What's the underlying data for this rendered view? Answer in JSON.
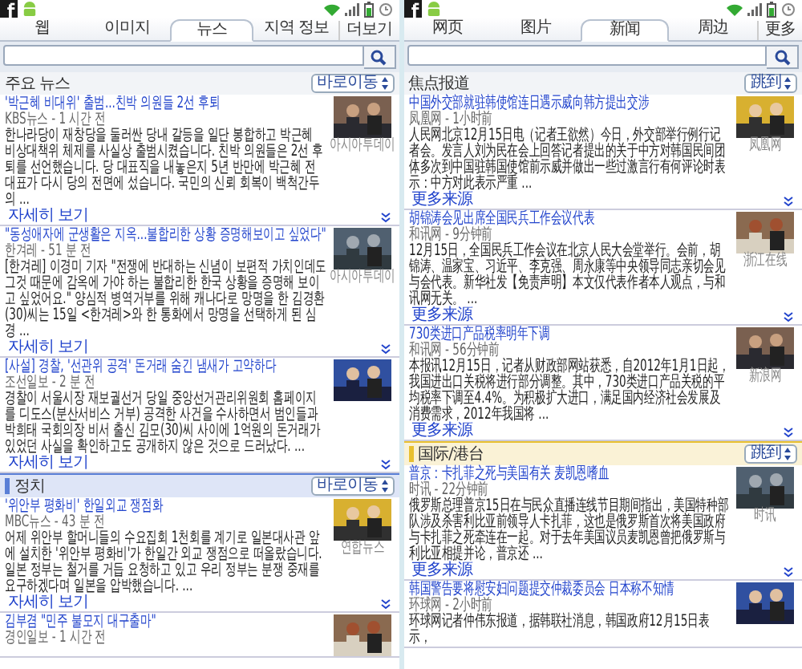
{
  "panels": [
    {
      "tabs": [
        {
          "label": "웹",
          "selected": false
        },
        {
          "label": "이미지",
          "selected": false
        },
        {
          "label": "뉴스",
          "selected": true
        },
        {
          "label": "지역 정보",
          "selected": false
        }
      ],
      "more_tab": "더보기",
      "sections": [
        {
          "kind": "top",
          "title": "주요 뉴스",
          "jump_label": "바로이동",
          "articles": [
            {
              "title": "'박근혜 비대위' 출범...친박 의원들 2선 후퇴",
              "source": "KBS뉴스 - 1 시간 전",
              "snippet": "한나라당이 재창당을 둘러싼 당내 갈등을 일단 봉합하고 박근혜 비상대책위 체제를 사실상 출범시켰습니다. 친박 의원들은 2선 후퇴를 선언했습니다. 당 대표직을 내놓은지 5년 반만에 박근혜 전 대표가 다시 당의 전면에 섰습니다. 국민의 신뢰 회복이 백척간두의 ...",
              "image_caption": "아시아투데이",
              "more_link": "자세히 보기"
            },
            {
              "title": "\"동성애자에 군생활은 지옥...불합리한 상황 증명해보이고 싶었다\"",
              "source": "한겨레 - 51 분 전",
              "snippet": "[한겨레] 이경미 기자 \"전쟁에 반대하는 신념이 보편적 가치인데도 그것 때문에 감옥에 가야 하는 불합리한 한국 상황을 증명해 보이고 싶었어요.\" 양심적 병역거부를 위해 캐나다로 망명을 한 김경환(30)씨는 15일 <한겨레>와 한 통화에서 망명을 선택하게 된 심경 ...",
              "image_caption": "아시아투데이",
              "more_link": "자세히 보기"
            },
            {
              "title": "[사설] 경찰, '선관위 공격' 돈거래 숨긴 냄새가 고약하다",
              "source": "조선일보 - 2 분 전",
              "snippet": "경찰이 서울시장 재보궐선거 당일 중앙선거관리위원회 홈페이지를 디도스(분산서비스 거부) 공격한 사건을 수사하면서 범인들과 박희태 국회의장 비서 출신 김모(30)씨 사이에 1억원의 돈거래가 있었던 사실을 확인하고도 공개하지 않은 것으로 드러났다. ...",
              "more_link": "자세히 보기"
            }
          ]
        },
        {
          "kind": "category",
          "title": "정치",
          "jump_label": "바로이동",
          "color": "#5a7fd6",
          "articles": [
            {
              "title": "'위안부 평화비' 한일외교 쟁점화",
              "source": "MBC뉴스 - 43 분 전",
              "snippet": "어제 위안부 할머니들의 수요집회 1천회를 계기로 일본대사관 앞에 설치한 '위안부 평화비'가 한일간 외교 쟁점으로 떠올랐습니다. 일본 정부는 철거를 거듭 요청하고 있고 우리 정부는 분쟁 중재를 요구하겠다며 일본을 압박했습니다. ...",
              "image_caption": "연합뉴스",
              "more_link": "자세히 보기"
            },
            {
              "title": "김부겸 \"민주 불모지 대구출마\"",
              "source": "경인일보 - 1 시간 전"
            }
          ]
        }
      ]
    },
    {
      "tabs": [
        {
          "label": "网页",
          "selected": false
        },
        {
          "label": "图片",
          "selected": false
        },
        {
          "label": "新闻",
          "selected": true
        },
        {
          "label": "周边",
          "selected": false
        }
      ],
      "more_tab": "更多",
      "sections": [
        {
          "kind": "top",
          "title": "焦点报道",
          "jump_label": "跳到",
          "articles": [
            {
              "title": "中国外交部就驻韩使馆连日遇示威向韩方提出交涉",
              "source": "凤凰网 - 1小时前",
              "snippet": "人民网北京12月15日电（记者王欲然）今日，外交部举行例行记者会。发言人刘为民在会上回答记者提出的关于中方对韩国民间团体多次到中国驻韩国使馆前示威并做出一些过激言行有何评论时表示：中方对此表示严重 ...",
              "image_caption": "凤凰网",
              "more_link": "更多来源"
            },
            {
              "title": "胡锦涛会见出席全国民兵工作会议代表",
              "source": "和讯网 - 9分钟前",
              "snippet": "12月15日，全国民兵工作会议在北京人民大会堂举行。会前，胡锦涛、温家宝、习近平、李克强、周永康等中央领导同志亲切会见与会代表。新华社发【免责声明】本文仅代表作者本人观点，与和讯网无关。 ...",
              "image_caption": "浙江在线",
              "more_link": "更多来源"
            },
            {
              "title": "730类进口产品税率明年下调",
              "source": "和讯网 - 56分钟前",
              "snippet": "本报讯12月15日，记者从财政部网站获悉，自2012年1月1日起，我国进出口关税将进行部分调整。其中，730类进口产品关税的平均税率下调至4.4%。为积极扩大进口，满足国内经济社会发展及消费需求，2012年我国将 ...",
              "image_caption": "新浪网",
              "more_link": "更多来源"
            }
          ]
        },
        {
          "kind": "category",
          "title": "国际/港台",
          "jump_label": "跳到",
          "color": "#e8c030",
          "articles": [
            {
              "title": "普京：卡扎菲之死与美国有关 麦凯恩嗜血",
              "source": "时讯 - 22分钟前",
              "snippet": "俄罗斯总理普京15日在与民众直播连线节目期间指出，美国特种部队涉及杀害利比亚前领导人卡扎菲，这也是俄罗斯首次将美国政府与卡扎菲之死牵连在一起。对于去年美国议员麦凯恩曾把俄罗斯与利比亚相提并论，普京还 ...",
              "image_caption": "时讯",
              "more_link": "更多来源"
            },
            {
              "title": "韩国警告要将慰安妇问题提交仲裁委员会 日本称不知情",
              "source": "环球网 - 2小时前",
              "snippet": "环球网记者仲伟东报道，据韩联社消息，韩国政府12月15日表示，"
            }
          ]
        }
      ]
    }
  ]
}
